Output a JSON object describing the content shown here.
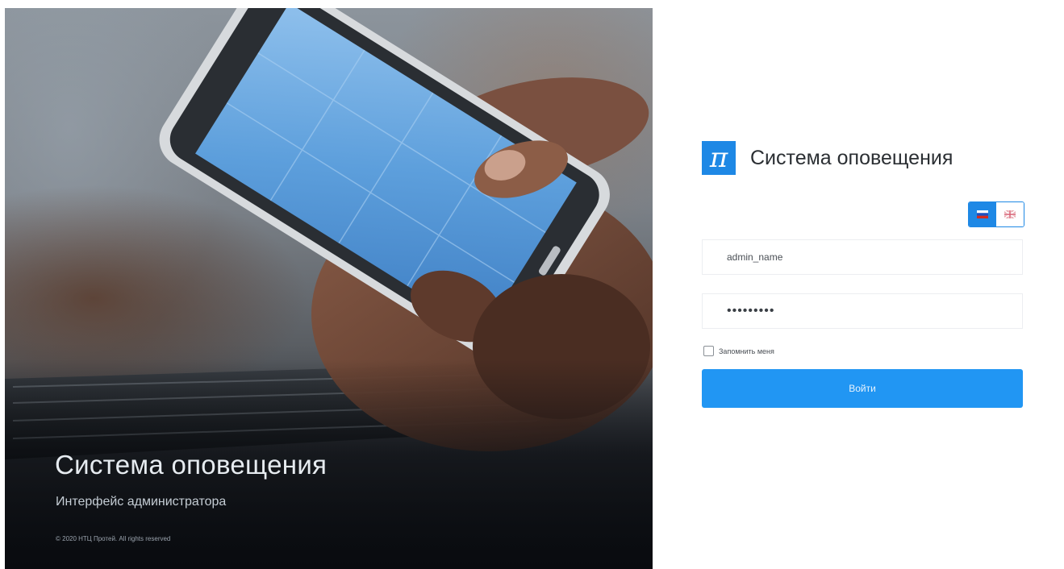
{
  "hero": {
    "title": "Система оповещения",
    "subtitle": "Интерфейс администратора",
    "copyright": "© 2020 НТЦ Протей. All rights reserved"
  },
  "login": {
    "logo_glyph": "π",
    "title": "Система оповещения",
    "languages": [
      {
        "code": "ru",
        "icon": "russia-flag-icon",
        "active": true
      },
      {
        "code": "en",
        "icon": "uk-flag-icon",
        "active": false
      }
    ],
    "username_value": "admin_name",
    "password_value": "•••••••••",
    "remember_label": "Запомнить меня",
    "remember_checked": false,
    "submit_label": "Войти",
    "accent_color": "#2196f3"
  }
}
